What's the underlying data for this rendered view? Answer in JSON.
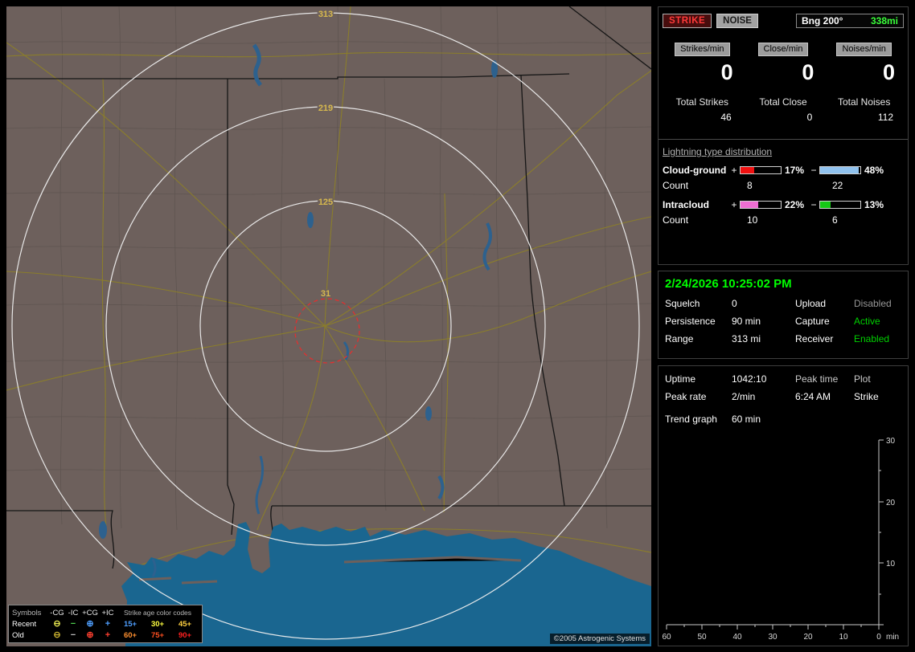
{
  "header": {
    "strike": "STRIKE",
    "noise": "NOISE",
    "bearing_label": "Bng 200°",
    "bearing_value": "338mi"
  },
  "rates": {
    "cols": [
      {
        "chip": "Strikes/min",
        "value": "0",
        "total_label": "Total Strikes",
        "total": "46"
      },
      {
        "chip": "Close/min",
        "value": "0",
        "total_label": "Total Close",
        "total": "0"
      },
      {
        "chip": "Noises/min",
        "value": "0",
        "total_label": "Total Noises",
        "total": "112"
      }
    ]
  },
  "distribution": {
    "title": "Lightning type distribution",
    "plus_sign": "+",
    "minus_sign": "−",
    "rows": [
      {
        "label": "Cloud-ground",
        "count_label": "Count",
        "plus": {
          "pct": "17%",
          "fill": 34,
          "color": "#f01010",
          "count": "8"
        },
        "minus": {
          "pct": "48%",
          "fill": 96,
          "color": "#90c2ee",
          "count": "22"
        }
      },
      {
        "label": "Intracloud",
        "count_label": "Count",
        "plus": {
          "pct": "22%",
          "fill": 44,
          "color": "#ee6ed2",
          "count": "10"
        },
        "minus": {
          "pct": "13%",
          "fill": 26,
          "color": "#16c816",
          "count": "6"
        }
      }
    ]
  },
  "status": {
    "timestamp": "2/24/2026 10:25:02 PM",
    "rows": [
      {
        "label1": "Squelch",
        "value1": "0",
        "label2": "Upload",
        "value2": "Disabled",
        "value2_color": "#969696"
      },
      {
        "label1": "Persistence",
        "value1": "90 min",
        "label2": "Capture",
        "value2": "Active",
        "value2_color": "#00d000"
      },
      {
        "label1": "Range",
        "value1": "313 mi",
        "label2": "Receiver",
        "value2": "Enabled",
        "value2_color": "#00d000"
      }
    ]
  },
  "stats": {
    "uptime_label": "Uptime",
    "uptime_value": "1042:10",
    "peak_time_label": "Peak time",
    "peak_time_value": "6:24 AM",
    "plot_label": "Plot",
    "plot_value": "Strike",
    "peak_rate_label": "Peak rate",
    "peak_rate_value": "2/min",
    "trend_label": "Trend graph",
    "trend_value": "60 min"
  },
  "chart_data": {
    "type": "line",
    "title": "Trend graph",
    "window": "60 min",
    "xlabel": "min",
    "x_direction": "countdown",
    "x_ticks": [
      60,
      50,
      40,
      30,
      20,
      10,
      0
    ],
    "ylim": [
      0,
      30
    ],
    "y_ticks": [
      0,
      10,
      20,
      30
    ],
    "grid": false,
    "legend_position": "none",
    "series": []
  },
  "map": {
    "ring_labels": [
      "313",
      "219",
      "125",
      "31"
    ],
    "copyright": "©2005 Astrogenic Systems",
    "legend": {
      "symbols_header": "Symbols",
      "columns": [
        "-CG",
        "-IC",
        "+CG",
        "+IC"
      ],
      "age_header": "Strike age color codes",
      "rows": [
        {
          "label": "Recent",
          "symbols": [
            {
              "glyph": "⊖",
              "color": "#e6e650"
            },
            {
              "glyph": "−",
              "color": "#50d050"
            },
            {
              "glyph": "⊕",
              "color": "#4f9fff"
            },
            {
              "glyph": "+",
              "color": "#4f9fff"
            }
          ],
          "ages": [
            {
              "text": "15+",
              "color": "#4f9fff"
            },
            {
              "text": "30+",
              "color": "#ffff40"
            },
            {
              "text": "45+",
              "color": "#ffd040"
            }
          ]
        },
        {
          "label": "Old",
          "symbols": [
            {
              "glyph": "⊖",
              "color": "#c8b030"
            },
            {
              "glyph": "−",
              "color": "#c0c0c0"
            },
            {
              "glyph": "⊕",
              "color": "#ff4030"
            },
            {
              "glyph": "+",
              "color": "#ff4030"
            }
          ],
          "ages": [
            {
              "text": "60+",
              "color": "#ff9030"
            },
            {
              "text": "75+",
              "color": "#ff5020"
            },
            {
              "text": "90+",
              "color": "#ff2020"
            }
          ]
        }
      ]
    }
  }
}
